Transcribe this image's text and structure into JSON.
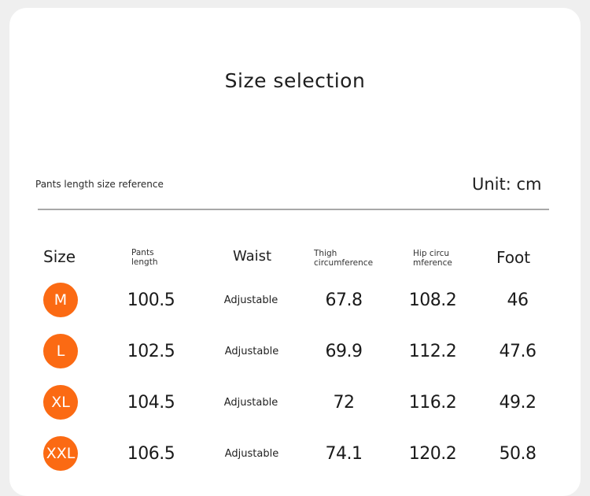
{
  "title": "Size selection",
  "subtitle": "Pants length size reference",
  "unit": "Unit: cm",
  "accent_color": "#fb6a13",
  "headers": {
    "size": "Size",
    "pants_length": [
      "Pants",
      "length"
    ],
    "waist": "Waist",
    "thigh": [
      "Thigh",
      "circumference"
    ],
    "hip": [
      "Hip circu",
      "mference"
    ],
    "foot": "Foot"
  },
  "rows": [
    {
      "size": "M",
      "pants_length": "100.5",
      "waist": "Adjustable",
      "thigh": "67.8",
      "hip": "108.2",
      "foot": "46"
    },
    {
      "size": "L",
      "pants_length": "102.5",
      "waist": "Adjustable",
      "thigh": "69.9",
      "hip": "112.2",
      "foot": "47.6"
    },
    {
      "size": "XL",
      "pants_length": "104.5",
      "waist": "Adjustable",
      "thigh": "72",
      "hip": "116.2",
      "foot": "49.2"
    },
    {
      "size": "XXL",
      "pants_length": "106.5",
      "waist": "Adjustable",
      "thigh": "74.1",
      "hip": "120.2",
      "foot": "50.8"
    }
  ]
}
